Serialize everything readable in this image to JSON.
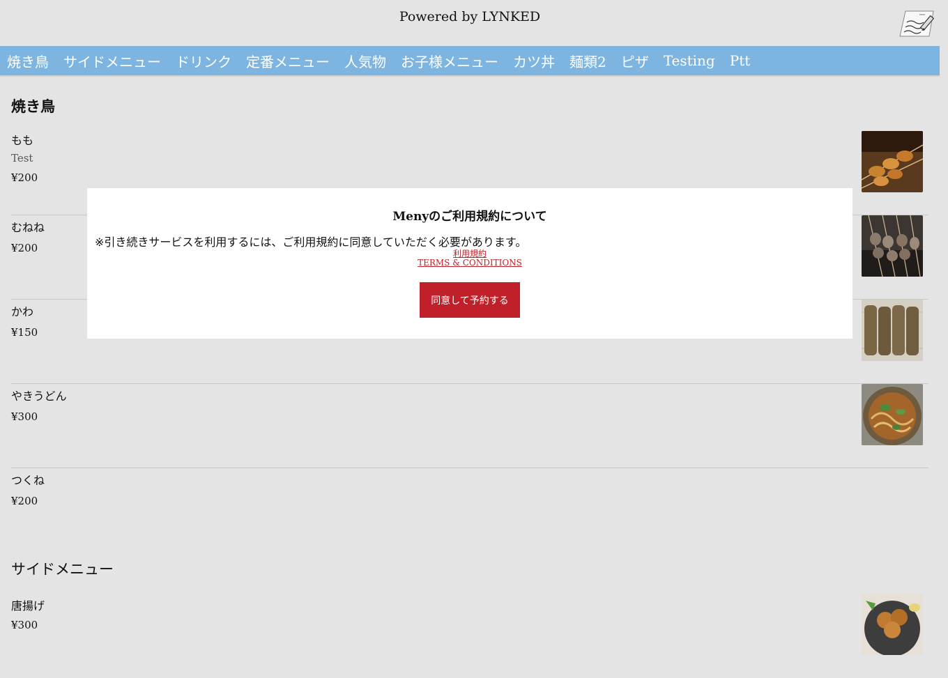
{
  "header": {
    "powered_by": "Powered by LYNKED"
  },
  "nav": {
    "items": [
      "焼き鳥",
      "サイドメニュー",
      "ドリンク",
      "定番メニュー",
      "人気物",
      "お子様メニュー",
      "カツ丼",
      "麺類2",
      "ピザ",
      "Testing",
      "Ptt"
    ]
  },
  "sections": [
    {
      "title": "焼き鳥",
      "items": [
        {
          "name": "もも",
          "desc": "Test",
          "price": "¥200"
        },
        {
          "name": "むねね",
          "price": "¥200"
        },
        {
          "name": "かわ",
          "price": "¥150"
        },
        {
          "name": "やきうどん",
          "price": "¥300"
        },
        {
          "name": "つくね",
          "price": "¥200"
        }
      ]
    },
    {
      "title": "サイドメニュー",
      "items": [
        {
          "name": "唐揚げ",
          "price": "¥300"
        }
      ]
    }
  ],
  "modal": {
    "title": "Menyのご利用規約について",
    "text": "※引き続きサービスを利用するには、ご利用規約に同意していただく必要があります。",
    "link_jp": "利用規約",
    "link_en": "TERMS & CONDITIONS",
    "agree_button": "同意して予約する"
  },
  "colors": {
    "nav_bg": "#7db5e0",
    "accent_red": "#c0202a",
    "page_bg": "#e4e4e4"
  }
}
